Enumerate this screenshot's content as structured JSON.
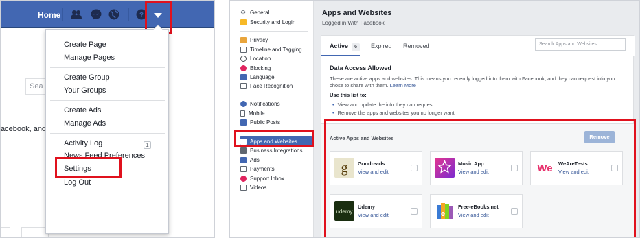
{
  "left_panel": {
    "nav": {
      "home_label": "Home"
    },
    "search_partial": "Sea",
    "cut_text": "acebook, and t",
    "dropdown": {
      "items": [
        "Create Page",
        "Manage Pages",
        "Create Group",
        "Your Groups",
        "Create Ads",
        "Manage Ads",
        "Activity Log",
        "News Feed Preferences",
        "Settings",
        "Log Out"
      ],
      "activity_badge": "1"
    }
  },
  "right_panel": {
    "sidebar": {
      "items": [
        {
          "label": "General",
          "icon": "gear-icon",
          "color": "#606770"
        },
        {
          "label": "Security and Login",
          "icon": "shield-icon",
          "color": "#f7b928"
        },
        {
          "label": "Privacy",
          "icon": "privacy-icon",
          "color": "#e9a53c"
        },
        {
          "label": "Timeline and Tagging",
          "icon": "timeline-icon",
          "color": "#606770"
        },
        {
          "label": "Location",
          "icon": "location-icon",
          "color": "#4b4f56"
        },
        {
          "label": "Blocking",
          "icon": "blocking-icon",
          "color": "#e0245e"
        },
        {
          "label": "Language",
          "icon": "language-icon",
          "color": "#4267b2"
        },
        {
          "label": "Face Recognition",
          "icon": "face-recognition-icon",
          "color": "#606770"
        },
        {
          "label": "Notifications",
          "icon": "globe-icon",
          "color": "#4267b2"
        },
        {
          "label": "Mobile",
          "icon": "mobile-icon",
          "color": "#606770"
        },
        {
          "label": "Public Posts",
          "icon": "public-posts-icon",
          "color": "#4267b2"
        },
        {
          "label": "Apps and Websites",
          "icon": "apps-icon",
          "color": "#ffffff"
        },
        {
          "label": "Business Integrations",
          "icon": "business-icon",
          "color": "#606770"
        },
        {
          "label": "Ads",
          "icon": "ads-icon",
          "color": "#4267b2"
        },
        {
          "label": "Payments",
          "icon": "payments-icon",
          "color": "#606770"
        },
        {
          "label": "Support Inbox",
          "icon": "support-icon",
          "color": "#e0245e"
        },
        {
          "label": "Videos",
          "icon": "videos-icon",
          "color": "#606770"
        }
      ]
    },
    "main": {
      "title": "Apps and Websites",
      "subtitle": "Logged in With Facebook",
      "tabs": [
        {
          "label": "Active",
          "count": "6"
        },
        {
          "label": "Expired"
        },
        {
          "label": "Removed"
        }
      ],
      "search_placeholder": "Search Apps and Websites",
      "data_access_title": "Data Access Allowed",
      "data_access_text": "These are active apps and websites. This means you recently logged into them with Facebook, and they can request info you chose to share with them.",
      "learn_more": "Learn More",
      "use_list_title": "Use this list to:",
      "bullets": [
        "View and update the info they can request",
        "Remove the apps and websites you no longer want"
      ],
      "active_title": "Active Apps and Websites",
      "remove_label": "Remove",
      "apps": [
        {
          "name": "Goodreads",
          "link": "View and edit"
        },
        {
          "name": "Music App",
          "link": "View and edit"
        },
        {
          "name": "WeAreTests",
          "link": "View and edit"
        },
        {
          "name": "Udemy",
          "link": "View and edit"
        },
        {
          "name": "Free-eBooks.net",
          "link": "View and edit"
        }
      ]
    }
  },
  "colors": {
    "facebook_blue": "#4267b2",
    "highlight_red": "#e0111d",
    "link_blue": "#385898"
  }
}
